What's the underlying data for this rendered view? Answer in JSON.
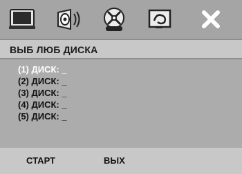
{
  "toolbar": {
    "icons": [
      {
        "name": "general-setup-icon"
      },
      {
        "name": "audio-setup-icon"
      },
      {
        "name": "disc-features-icon"
      },
      {
        "name": "preferences-icon"
      },
      {
        "name": "exit-icon"
      }
    ]
  },
  "title": "ВЫБ ЛЮБ ДИСКА",
  "items": [
    {
      "label": "(1) ДИСК: _"
    },
    {
      "label": "(2) ДИСК: _"
    },
    {
      "label": "(3) ДИСК: _"
    },
    {
      "label": "(4) ДИСК: _"
    },
    {
      "label": "(5) ДИСК: _"
    }
  ],
  "buttons": {
    "start": "СТАРТ",
    "exit": "ВЫХ"
  },
  "colors": {
    "background": "#acacac",
    "icon_bar": "#a5a5a5",
    "title_bar": "#c8c8c8",
    "highlight_text": "#ffffff",
    "text": "#111111"
  }
}
